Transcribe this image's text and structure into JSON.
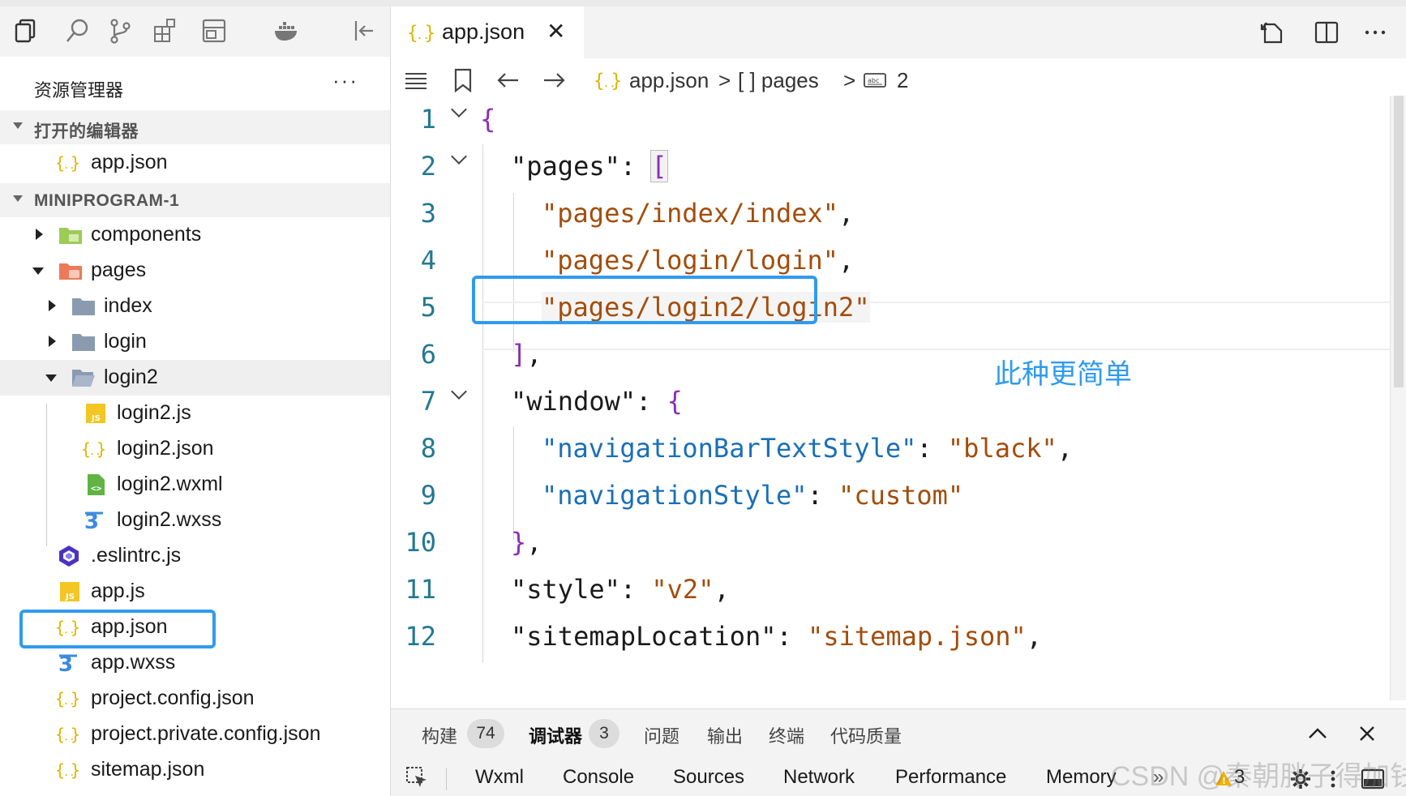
{
  "sidebar": {
    "activity_icons": [
      "files-icon",
      "search-icon",
      "source-control-icon",
      "extensions-icon",
      "layout-icon",
      "docker-icon",
      "collapse-sidebar-icon"
    ],
    "title": "资源管理器",
    "more": "···",
    "open_editors": {
      "header": "打开的编辑器",
      "items": [
        {
          "name": "app.json"
        }
      ]
    },
    "project": {
      "header": "MINIPROGRAM-1",
      "items": [
        {
          "name": "components"
        },
        {
          "name": "pages"
        },
        {
          "name": "index"
        },
        {
          "name": "login"
        },
        {
          "name": "login2"
        },
        {
          "name": "login2.js"
        },
        {
          "name": "login2.json"
        },
        {
          "name": "login2.wxml"
        },
        {
          "name": "login2.wxss"
        },
        {
          "name": ".eslintrc.js"
        },
        {
          "name": "app.js"
        },
        {
          "name": "app.json"
        },
        {
          "name": "app.wxss"
        },
        {
          "name": "project.config.json"
        },
        {
          "name": "project.private.config.json"
        },
        {
          "name": "sitemap.json"
        }
      ]
    }
  },
  "editor": {
    "tab": {
      "name": "app.json",
      "close": "✕"
    },
    "breadcrumb": {
      "file": "app.json",
      "sep1": ">",
      "array": "[ ] pages",
      "sep2": ">",
      "index": "2"
    },
    "lines": [
      "1",
      "2",
      "3",
      "4",
      "5",
      "6",
      "7",
      "8",
      "9",
      "10",
      "11",
      "12"
    ],
    "code": {
      "open_brace": "{",
      "pages_key": "\"pages\"",
      "colon": ": ",
      "open_bracket": "[",
      "page1": "\"pages/index/index\"",
      "page2": "\"pages/login/login\"",
      "page3": "\"pages/login2/login2\"",
      "comma": ",",
      "close_bracket": "]",
      "window_key": "\"window\"",
      "nav_text_key": "\"navigationBarTextStyle\"",
      "nav_text_val": "\"black\"",
      "nav_style_key": "\"navigationStyle\"",
      "nav_style_val": "\"custom\"",
      "close_brace": "}",
      "style_key": "\"style\"",
      "style_val": "\"v2\"",
      "sitemap_key": "\"sitemapLocation\"",
      "sitemap_val": "\"sitemap.json\""
    },
    "annotation": "此种更简单"
  },
  "panel": {
    "tabs": [
      {
        "label": "构建",
        "badge": "74"
      },
      {
        "label": "调试器",
        "badge": "3"
      },
      {
        "label": "问题"
      },
      {
        "label": "输出"
      },
      {
        "label": "终端"
      },
      {
        "label": "代码质量"
      }
    ],
    "subtabs": [
      "Wxml",
      "Console",
      "Sources",
      "Network",
      "Performance",
      "Memory"
    ],
    "overflow": "»",
    "warn_count": "3"
  },
  "watermark": "CSDN @秦朝胖子得加钱",
  "colors": {
    "accent": "#2f9bef",
    "json_icon": "#e0b400",
    "folder": "#8a9bb0"
  }
}
